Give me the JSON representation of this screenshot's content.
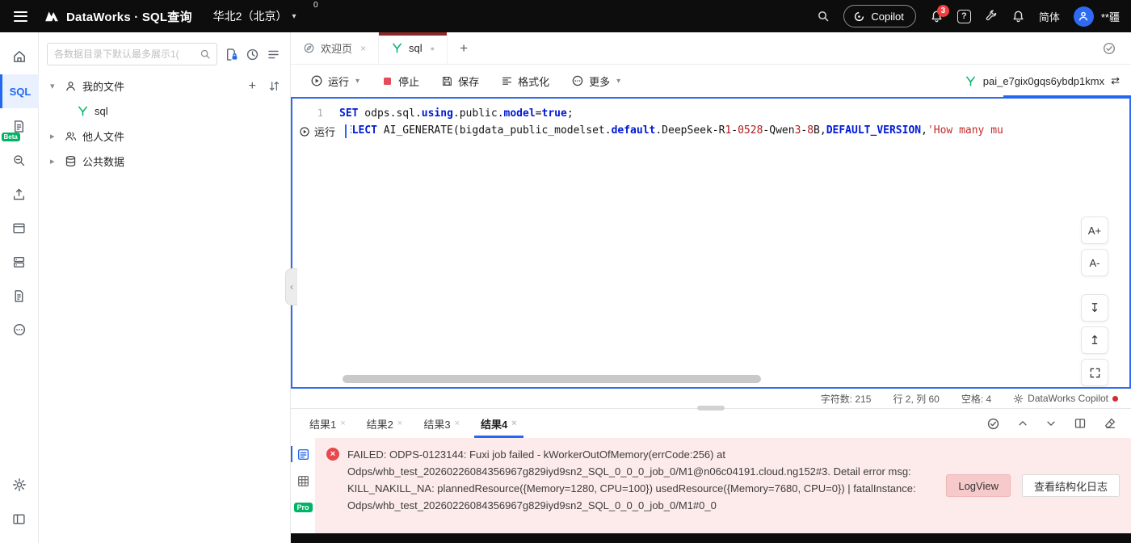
{
  "glyphs": {
    "chevron_down": "▾",
    "chevron_right": "▸",
    "close": "×",
    "plus": "+",
    "collapse_left": "‹",
    "swap": "⇄",
    "question": "?",
    "font_up": "A+",
    "font_down": "A-",
    "arrow_down_bar": "↧",
    "arrow_up_bar": "↥",
    "modified_dot": "●"
  },
  "topbar": {
    "product_title": "DataWorks · SQL查询",
    "region": "华北2（北京）",
    "counter": "0",
    "copilot_label": "Copilot",
    "notification_count": "3",
    "language": "简体",
    "username": "**疆"
  },
  "sidebar": {
    "sql_label": "SQL",
    "beta_badge": "Beta"
  },
  "explorer": {
    "search_placeholder": "各数据目录下默认最多展示1(",
    "my_files": "我的文件",
    "sql_file": "sql",
    "others_files": "他人文件",
    "public_data": "公共数据"
  },
  "tabs": {
    "welcome": "欢迎页",
    "sql": "sql"
  },
  "toolbar": {
    "run": "运行",
    "stop": "停止",
    "save": "保存",
    "format": "格式化",
    "more": "更多",
    "resource": "pai_e7gix0gqs6ybdp1kmx"
  },
  "editor": {
    "gutter_run_label": "运行",
    "line1": {
      "no": "1",
      "tokens": [
        {
          "t": "SET"
        },
        {
          "t": " odps.sql."
        },
        {
          "t": "using"
        },
        {
          "t": "."
        },
        {
          "t": "public"
        },
        {
          "t": "."
        },
        {
          "t": "model"
        },
        {
          "t": "="
        },
        {
          "t": "true"
        },
        {
          "t": ";"
        }
      ]
    },
    "line2": {
      "tokens": [
        {
          "t": "SELECT"
        },
        {
          "t": " AI_GENERATE(bigdata_public_modelset."
        },
        {
          "t": "default"
        },
        {
          "t": ".DeepSeek-R"
        },
        {
          "t": "1"
        },
        {
          "t": "-"
        },
        {
          "t": "0528"
        },
        {
          "t": "-Qwen"
        },
        {
          "t": "3"
        },
        {
          "t": "-"
        },
        {
          "t": "8"
        },
        {
          "t": "B,"
        },
        {
          "t": "DEFAULT_VERSION"
        },
        {
          "t": ","
        },
        {
          "t": "'How many mu"
        }
      ]
    }
  },
  "statusbar": {
    "char_count": "字符数: 215",
    "cursor_pos": "行 2, 列 60",
    "spaces": "空格: 4",
    "copilot": "DataWorks Copilot"
  },
  "results": {
    "tabs": [
      "结果1",
      "结果2",
      "结果3",
      "结果4"
    ],
    "pro_badge": "Pro",
    "error": {
      "lines": [
        "FAILED: ODPS-0123144: Fuxi job failed - kWorkerOutOfMemory(errCode:256) at",
        "Odps/whb_test_20260226084356967g829iyd9sn2_SQL_0_0_0_job_0/M1@n06c04191.cloud.ng152#3. Detail error msg:",
        "KILL_NAKILL_NA: plannedResource({Memory=1280, CPU=100}) usedResource({Memory=7680, CPU=0}) | fatalInstance:",
        "Odps/whb_test_20260226084356967g829iyd9sn2_SQL_0_0_0_job_0/M1#0_0"
      ],
      "logview_button": "LogView",
      "structured_log_button": "查看结构化日志"
    }
  },
  "colors": {
    "accent_blue": "#2468f2",
    "error_red": "#e5484d",
    "error_bg": "#fdeaea",
    "beta_green": "#00b365",
    "tab_indicator": "#8a2727"
  }
}
